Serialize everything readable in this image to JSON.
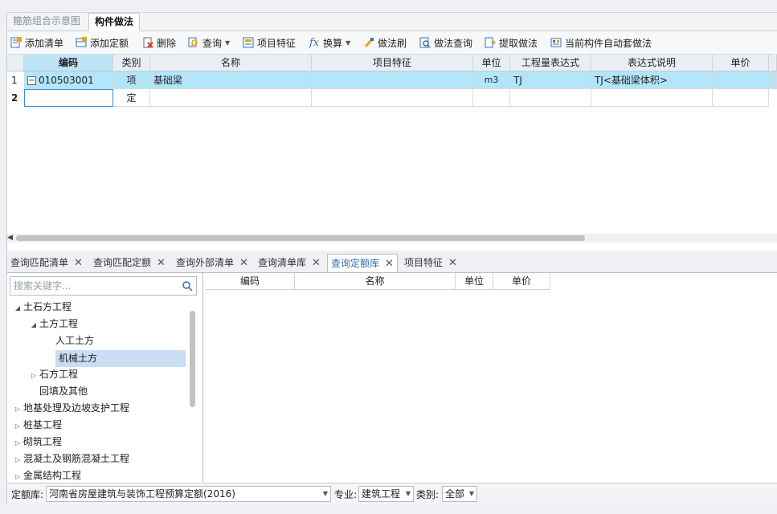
{
  "upper_tabs": [
    {
      "label": "箍筋组合示意图",
      "active": false
    },
    {
      "label": "构件做法",
      "active": true
    }
  ],
  "toolbar": {
    "add_list": "添加清单",
    "add_quota": "添加定额",
    "delete": "删除",
    "query": "查询",
    "item_feature": "项目特征",
    "convert_fx": "fx",
    "convert": "换算",
    "method_brush": "做法刷",
    "method_query": "做法查询",
    "extract_method": "提取做法",
    "auto_method": "当前构件自动套做法"
  },
  "grid": {
    "columns": [
      "编码",
      "类别",
      "名称",
      "项目特征",
      "单位",
      "工程量表达式",
      "表达式说明",
      "单价"
    ],
    "rows": [
      {
        "num": "1",
        "expander": "−",
        "code": "010503001",
        "type": "项",
        "name": "基础梁",
        "feature": "",
        "unit": "m3",
        "expr": "TJ",
        "expr_desc": "TJ<基础梁体积>",
        "price": ""
      },
      {
        "num": "2",
        "expander": "",
        "code": "",
        "type": "定",
        "name": "",
        "feature": "",
        "unit": "",
        "expr": "",
        "expr_desc": "",
        "price": ""
      }
    ]
  },
  "lower_tabs": [
    {
      "label": "查询匹配清单",
      "active": false
    },
    {
      "label": "查询匹配定额",
      "active": false
    },
    {
      "label": "查询外部清单",
      "active": false
    },
    {
      "label": "查询清单库",
      "active": false
    },
    {
      "label": "查询定额库",
      "active": true
    },
    {
      "label": "项目特征",
      "active": false
    }
  ],
  "close_glyph": "✕",
  "search": {
    "placeholder": "搜索关键字..."
  },
  "tree": [
    {
      "label": "土石方工程",
      "level": 0,
      "state": "expanded"
    },
    {
      "label": "土方工程",
      "level": 1,
      "state": "expanded"
    },
    {
      "label": "人工土方",
      "level": 2,
      "state": "leaf"
    },
    {
      "label": "机械土方",
      "level": 2,
      "state": "leaf",
      "selected": true
    },
    {
      "label": "石方工程",
      "level": 1,
      "state": "collapsed"
    },
    {
      "label": "回填及其他",
      "level": 1,
      "state": "leaf"
    },
    {
      "label": "地基处理及边坡支护工程",
      "level": 0,
      "state": "collapsed"
    },
    {
      "label": "桩基工程",
      "level": 0,
      "state": "collapsed"
    },
    {
      "label": "砌筑工程",
      "level": 0,
      "state": "collapsed"
    },
    {
      "label": "混凝土及钢筋混凝土工程",
      "level": 0,
      "state": "collapsed"
    },
    {
      "label": "金属结构工程",
      "level": 0,
      "state": "collapsed"
    }
  ],
  "result_columns": [
    "编码",
    "名称",
    "单位",
    "单价"
  ],
  "bottom": {
    "quota_lib_label": "定额库:",
    "quota_lib_value": "河南省房屋建筑与装饰工程预算定额(2016)",
    "major_label": "专业:",
    "major_value": "建筑工程",
    "category_label": "类别:",
    "category_value": "全部"
  },
  "colors": {
    "selected_row": "#b3e5fa",
    "active_tab_text": "#2f6db5",
    "tree_selected": "#c9ddf4"
  }
}
